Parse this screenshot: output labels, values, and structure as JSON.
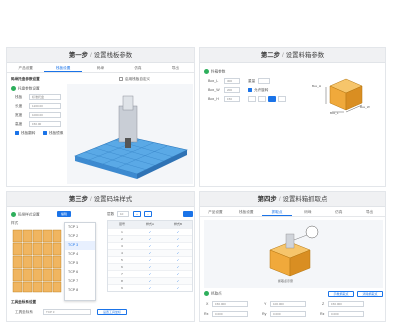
{
  "step1": {
    "title": "第一步",
    "subtitle": "设置栈板参数",
    "tabs": [
      "产品设置",
      "栈板设置",
      "码垛",
      "仿真",
      "导出"
    ],
    "active_tab": 1,
    "section": "码垛托盘参数设置",
    "option_label": "托盘参数设置",
    "checkbox_label": "启用栈板自定义",
    "fields": [
      {
        "label": "栈板",
        "value": "标准托盘"
      },
      {
        "label": "长度",
        "value": "1200.00"
      },
      {
        "label": "宽度",
        "value": "1000.00"
      },
      {
        "label": "高度",
        "value": "150.00"
      }
    ],
    "switches": [
      "栈板翻转",
      "栈板镜像"
    ]
  },
  "step2": {
    "title": "第二步",
    "subtitle": "设置料箱参数",
    "section": "料箱参数",
    "rows": [
      {
        "label": "Box_L",
        "value": "300"
      },
      {
        "label": "Box_W",
        "value": "200"
      },
      {
        "label": "Box_H",
        "value": "150"
      }
    ],
    "side_label": "重量",
    "check_label": "允许旋转",
    "box_labels": [
      "Box_L",
      "Box_W",
      "Box_H"
    ]
  },
  "step3": {
    "title": "第三步",
    "subtitle": "设置码垛样式",
    "section": "码垛样式设置",
    "button": "编辑",
    "layer_label": "样式",
    "dropdown": [
      "TCP 1",
      "TCP 2",
      "TCP 3",
      "TCP 4",
      "TCP 5",
      "TCP 6",
      "TCP 7",
      "TCP 8"
    ],
    "selected": 2,
    "table_headers": [
      "层号",
      "样式A",
      "样式B"
    ],
    "table_rows": [
      "1",
      "2",
      "3",
      "4",
      "5",
      "6",
      "7",
      "8",
      "9"
    ],
    "toolbar_label": "层数",
    "toolbar_value": "10",
    "footer_title": "工具坐标系设置",
    "footer_label": "工具坐标系",
    "footer_value": "TCP 3",
    "footer_button": "设置工具坐标"
  },
  "step4": {
    "title": "第四步",
    "subtitle": "设置料箱抓取点",
    "tabs": [
      "产品设置",
      "栈板设置",
      "抓取点",
      "码垛",
      "仿真",
      "导出"
    ],
    "active_tab": 2,
    "section": "抓取点",
    "buttons": [
      "示教抓取点",
      "清除抓取点"
    ],
    "caption": "抓取点示意",
    "fields": [
      {
        "label": "X",
        "value": "150.000"
      },
      {
        "label": "Y",
        "value": "100.000"
      },
      {
        "label": "Z",
        "value": "150.000"
      },
      {
        "label": "Rx",
        "value": "0.000"
      },
      {
        "label": "Ry",
        "value": "0.000"
      },
      {
        "label": "Rz",
        "value": "0.000"
      }
    ]
  },
  "colors": {
    "accent": "#1a73e8",
    "ok": "#2eaf5c",
    "box": "#f0a93b",
    "pallet": "#5aa9e6"
  }
}
